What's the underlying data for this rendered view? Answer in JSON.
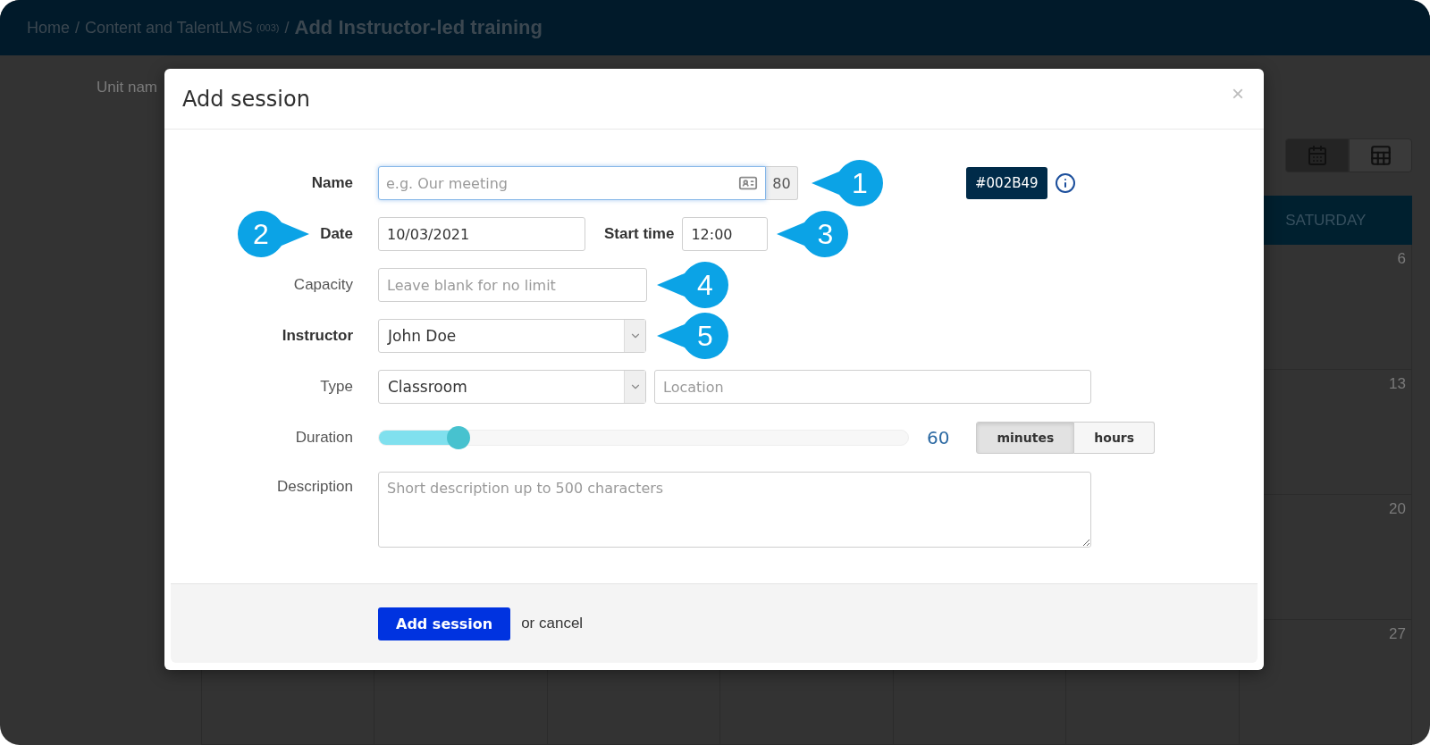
{
  "breadcrumb": [
    {
      "kind": "link",
      "text": "Home"
    },
    {
      "kind": "link",
      "separator": "/",
      "text": "Content and TalentLMS",
      "note": "(003)"
    },
    {
      "kind": "current",
      "separator": "/",
      "text": "Add Instructor-led training"
    }
  ],
  "unit_label": "Unit nam",
  "calendar": {
    "views": [
      {
        "selected": true
      },
      {
        "selected": false
      }
    ],
    "header": "SATURDAY",
    "day_numbers": [
      "6",
      "13",
      "20",
      "27"
    ]
  },
  "modal": {
    "title": "Add session",
    "close": "×",
    "name": {
      "label": "Name",
      "required": true,
      "placeholder": "e.g. Our meeting",
      "focused": true,
      "counter": "80",
      "callout": "1"
    },
    "color_code": {
      "text": "#002B49",
      "color": "#002b49"
    },
    "date": {
      "label": "Date",
      "required": true,
      "value": "10/03/2021",
      "callout": "2"
    },
    "start_time": {
      "label": "Start time",
      "required": true,
      "value": "12:00",
      "callout": "3"
    },
    "capacity": {
      "label": "Capacity",
      "required": false,
      "placeholder": "Leave blank for no limit",
      "callout": "4"
    },
    "instructor": {
      "label": "Instructor",
      "required": true,
      "value": "John Doe",
      "callout": "5"
    },
    "type": {
      "label": "Type",
      "required": false,
      "value": "Classroom",
      "location_placeholder": "Location"
    },
    "duration": {
      "label": "Duration",
      "required": false,
      "level": 0.15,
      "reading": "60",
      "units": [
        {
          "label": "minutes",
          "selected": true
        },
        {
          "label": "hours",
          "selected": false
        }
      ]
    },
    "description": {
      "label": "Description",
      "required": false,
      "placeholder": "Short description up to 500 characters"
    },
    "submit": "Add session",
    "cancel": "or cancel"
  }
}
